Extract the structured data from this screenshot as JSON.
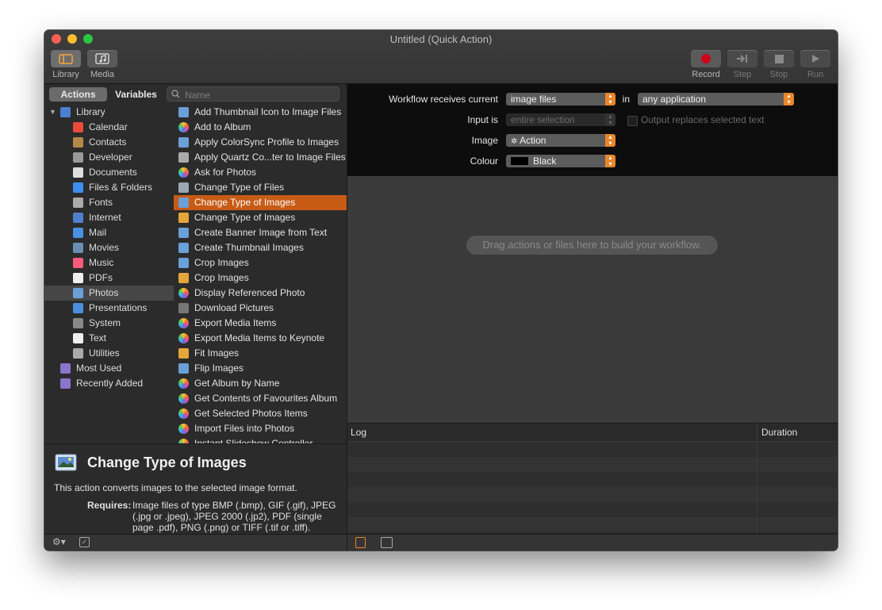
{
  "window": {
    "title": "Untitled (Quick Action)"
  },
  "toolbar": {
    "library_label": "Library",
    "media_label": "Media",
    "record_label": "Record",
    "step_label": "Step",
    "stop_label": "Stop",
    "run_label": "Run",
    "accent_record": "#d0021b"
  },
  "left": {
    "tabs": {
      "actions": "Actions",
      "variables": "Variables"
    },
    "search_placeholder": "Name",
    "library": [
      {
        "label": "Library",
        "icon": "library-icon",
        "level": 0,
        "disclosure": true
      },
      {
        "label": "Calendar",
        "icon": "calendar-icon",
        "level": 1
      },
      {
        "label": "Contacts",
        "icon": "contacts-icon",
        "level": 1
      },
      {
        "label": "Developer",
        "icon": "developer-icon",
        "level": 1
      },
      {
        "label": "Documents",
        "icon": "documents-icon",
        "level": 1
      },
      {
        "label": "Files & Folders",
        "icon": "finder-icon",
        "level": 1
      },
      {
        "label": "Fonts",
        "icon": "fonts-icon",
        "level": 1
      },
      {
        "label": "Internet",
        "icon": "internet-icon",
        "level": 1
      },
      {
        "label": "Mail",
        "icon": "mail-icon",
        "level": 1
      },
      {
        "label": "Movies",
        "icon": "movies-icon",
        "level": 1
      },
      {
        "label": "Music",
        "icon": "music-icon",
        "level": 1
      },
      {
        "label": "PDFs",
        "icon": "pdf-icon",
        "level": 1
      },
      {
        "label": "Photos",
        "icon": "photos-icon",
        "level": 1,
        "selected": true
      },
      {
        "label": "Presentations",
        "icon": "presentations-icon",
        "level": 1
      },
      {
        "label": "System",
        "icon": "system-icon",
        "level": 1
      },
      {
        "label": "Text",
        "icon": "text-icon",
        "level": 1
      },
      {
        "label": "Utilities",
        "icon": "utilities-icon",
        "level": 1
      },
      {
        "label": "Most Used",
        "icon": "smart-folder-icon",
        "level": 0
      },
      {
        "label": "Recently Added",
        "icon": "smart-folder-icon",
        "level": 0
      }
    ],
    "actions": [
      {
        "label": "Add Thumbnail Icon to Image Files",
        "icon": "preview-icon"
      },
      {
        "label": "Add to Album",
        "icon": "photos-app-icon"
      },
      {
        "label": "Apply ColorSync Profile to Images",
        "icon": "preview-icon"
      },
      {
        "label": "Apply Quartz Co...ter to Image Files",
        "icon": "tools-icon"
      },
      {
        "label": "Ask for Photos",
        "icon": "photos-app-icon"
      },
      {
        "label": "Change Type of Files",
        "icon": "automator-icon"
      },
      {
        "label": "Change Type of Images",
        "icon": "preview-icon",
        "selected": true
      },
      {
        "label": "Change Type of Images",
        "icon": "image-icon"
      },
      {
        "label": "Create Banner Image from Text",
        "icon": "preview-icon"
      },
      {
        "label": "Create Thumbnail Images",
        "icon": "preview-icon"
      },
      {
        "label": "Crop Images",
        "icon": "preview-icon"
      },
      {
        "label": "Crop Images",
        "icon": "image-icon"
      },
      {
        "label": "Display Referenced Photo",
        "icon": "photos-app-icon"
      },
      {
        "label": "Download Pictures",
        "icon": "camera-icon"
      },
      {
        "label": "Export Media Items",
        "icon": "photos-app-icon"
      },
      {
        "label": "Export Media Items to Keynote",
        "icon": "photos-app-icon"
      },
      {
        "label": "Fit Images",
        "icon": "image-icon"
      },
      {
        "label": "Flip Images",
        "icon": "preview-icon"
      },
      {
        "label": "Get Album by Name",
        "icon": "photos-app-icon"
      },
      {
        "label": "Get Contents of Favourites Album",
        "icon": "photos-app-icon"
      },
      {
        "label": "Get Selected Photos Items",
        "icon": "photos-app-icon"
      },
      {
        "label": "Import Files into Photos",
        "icon": "photos-app-icon"
      },
      {
        "label": "Instant Slideshow Controller",
        "icon": "photos-app-icon"
      }
    ],
    "description": {
      "title": "Change Type of Images",
      "text": "This action converts images to the selected image format.",
      "requires_label": "Requires:",
      "requires_text": "Image files of type BMP (.bmp), GIF (.gif), JPEG (.jpg or .jpeg), JPEG 2000 (.jp2), PDF (single page .pdf), PNG (.png) or TIFF (.tif or .tiff)."
    }
  },
  "workflow": {
    "receives_label": "Workflow receives current",
    "receives_value": "image files",
    "in_label": "in",
    "app_value": "any application",
    "input_is_label": "Input is",
    "input_is_value": "entire selection",
    "output_replaces_label": "Output replaces selected text",
    "image_label": "Image",
    "image_value": "Action",
    "colour_label": "Colour",
    "colour_value": "Black",
    "drop_message": "Drag actions or files here to build your workflow."
  },
  "log": {
    "log_header": "Log",
    "duration_header": "Duration"
  },
  "colors": {
    "accent": "#c75b16",
    "popup_arrow": "#e9872a"
  }
}
